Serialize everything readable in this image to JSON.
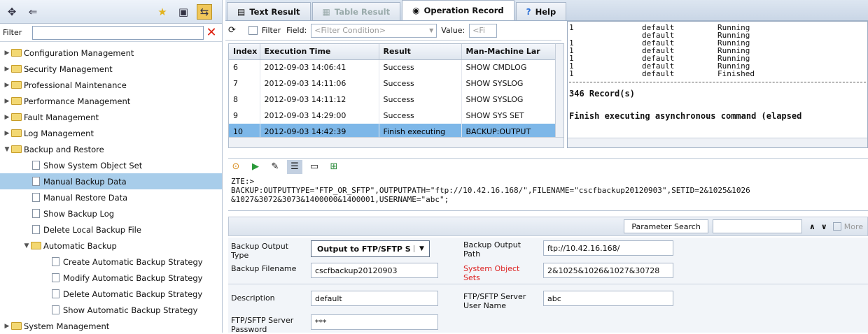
{
  "left_panel": {
    "filter_label": "Filter",
    "filter_value": "",
    "tree": [
      {
        "label": "Configuration Management",
        "type": "folder",
        "state": "collapsed",
        "level": 0
      },
      {
        "label": "Security Management",
        "type": "folder",
        "state": "collapsed",
        "level": 0
      },
      {
        "label": "Professional Maintenance",
        "type": "folder",
        "state": "collapsed",
        "level": 0
      },
      {
        "label": "Performance Management",
        "type": "folder",
        "state": "collapsed",
        "level": 0
      },
      {
        "label": "Fault Management",
        "type": "folder",
        "state": "collapsed",
        "level": 0
      },
      {
        "label": "Log Management",
        "type": "folder",
        "state": "collapsed",
        "level": 0
      },
      {
        "label": "Backup and Restore",
        "type": "folder",
        "state": "expanded",
        "level": 0
      },
      {
        "label": "Show System Object Set",
        "type": "item",
        "level": 1
      },
      {
        "label": "Manual Backup Data",
        "type": "item",
        "level": 1,
        "selected": true
      },
      {
        "label": "Manual Restore Data",
        "type": "item",
        "level": 1
      },
      {
        "label": "Show Backup Log",
        "type": "item",
        "level": 1
      },
      {
        "label": "Delete Local Backup File",
        "type": "item",
        "level": 1
      },
      {
        "label": "Automatic Backup",
        "type": "folder",
        "state": "expanded",
        "level": 1
      },
      {
        "label": "Create Automatic Backup Strategy",
        "type": "item",
        "level": 2
      },
      {
        "label": "Modify Automatic Backup Strategy",
        "type": "item",
        "level": 2
      },
      {
        "label": "Delete Automatic Backup Strategy",
        "type": "item",
        "level": 2
      },
      {
        "label": "Show Automatic Backup Strategy",
        "type": "item",
        "level": 2
      },
      {
        "label": "System Management",
        "type": "folder",
        "state": "collapsed",
        "level": 0
      }
    ]
  },
  "tabs": [
    {
      "label": "Text Result",
      "state": "normal"
    },
    {
      "label": "Table Result",
      "state": "disabled"
    },
    {
      "label": "Operation Record",
      "state": "active"
    },
    {
      "label": "Help",
      "state": "normal"
    }
  ],
  "record_toolbar": {
    "filter_label": "Filter",
    "field_label": "Field:",
    "field_placeholder": "<Filter Condition>",
    "value_label": "Value:",
    "value_placeholder": "<Fi"
  },
  "record_table": {
    "columns": [
      "Index",
      "Execution Time",
      "Result",
      "Man-Machine Lar"
    ],
    "rows": [
      {
        "index": "6",
        "time": "2012-09-03 14:06:41",
        "result": "Success",
        "cmd": "SHOW CMDLOG"
      },
      {
        "index": "7",
        "time": "2012-09-03 14:11:06",
        "result": "Success",
        "cmd": "SHOW SYSLOG"
      },
      {
        "index": "8",
        "time": "2012-09-03 14:11:12",
        "result": "Success",
        "cmd": "SHOW SYSLOG"
      },
      {
        "index": "9",
        "time": "2012-09-03 14:29:00",
        "result": "Success",
        "cmd": "SHOW SYS SET"
      },
      {
        "index": "10",
        "time": "2012-09-03 14:42:39",
        "result": "Finish executing",
        "cmd": "BACKUP:OUTPUT",
        "selected": true
      }
    ]
  },
  "console": {
    "lines": [
      {
        "c1": "1",
        "c2": "default",
        "c3": "Running"
      },
      {
        "c1": "",
        "c2": "default",
        "c3": "Running"
      },
      {
        "c1": "1",
        "c2": "default",
        "c3": "Running"
      },
      {
        "c1": "1",
        "c2": "default",
        "c3": "Running"
      },
      {
        "c1": "1",
        "c2": "default",
        "c3": "Running"
      },
      {
        "c1": "1",
        "c2": "default",
        "c3": "Running"
      },
      {
        "c1": "1",
        "c2": "default",
        "c3": "Finished"
      }
    ],
    "record_count": "346 Record(s)",
    "finish_text": "Finish executing asynchronous command (elapsed"
  },
  "command": {
    "prompt": "ZTE:>",
    "line1": "BACKUP:OUTPUTTYPE=\"FTP_OR_SFTP\",OUTPUTPATH=\"ftp://10.42.16.168/\",FILENAME=\"cscfbackup20120903\",SETID=2&1025&1026",
    "line2": "&1027&3072&3073&1400000&1400001,USERNAME=\"abc\";"
  },
  "param_header": {
    "search_label": "Parameter Search",
    "more_label": "More"
  },
  "form": {
    "backup_output_type_label": "Backup Output Type",
    "backup_output_type_value": "Output to FTP/SFTP S",
    "backup_output_path_label": "Backup Output Path",
    "backup_output_path_value": "ftp://10.42.16.168/",
    "backup_filename_label": "Backup Filename",
    "backup_filename_value": "cscfbackup20120903",
    "system_object_sets_label": "System Object Sets",
    "system_object_sets_value": "2&1025&1026&1027&30728",
    "description_label": "Description",
    "description_value": "default",
    "ftp_user_label": "FTP/SFTP Server User Name",
    "ftp_user_value": "abc",
    "ftp_password_label": "FTP/SFTP Server Password",
    "ftp_password_value": "***"
  },
  "colors": {
    "selection": "#a8cdea",
    "row_highlight": "#7db7e8",
    "required_label": "#d22"
  }
}
